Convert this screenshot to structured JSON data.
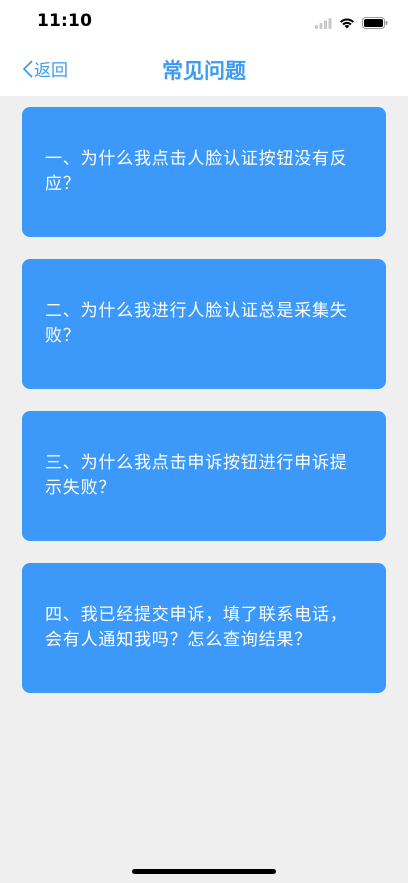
{
  "status_bar": {
    "time": "11:10"
  },
  "nav": {
    "back_label": "返回",
    "title": "常见问题"
  },
  "faq": [
    {
      "question": "一、为什么我点击人脸认证按钮没有反应？"
    },
    {
      "question": "二、为什么我进行人脸认证总是采集失败？"
    },
    {
      "question": "三、为什么我点击申诉按钮进行申诉提示失败？"
    },
    {
      "question": "四、我已经提交申诉，填了联系电话，会有人通知我吗？怎么查询结果？"
    }
  ],
  "colors": {
    "accent": "#3d9bf0",
    "card_background": "#3d99f9",
    "page_background": "#efefef"
  }
}
